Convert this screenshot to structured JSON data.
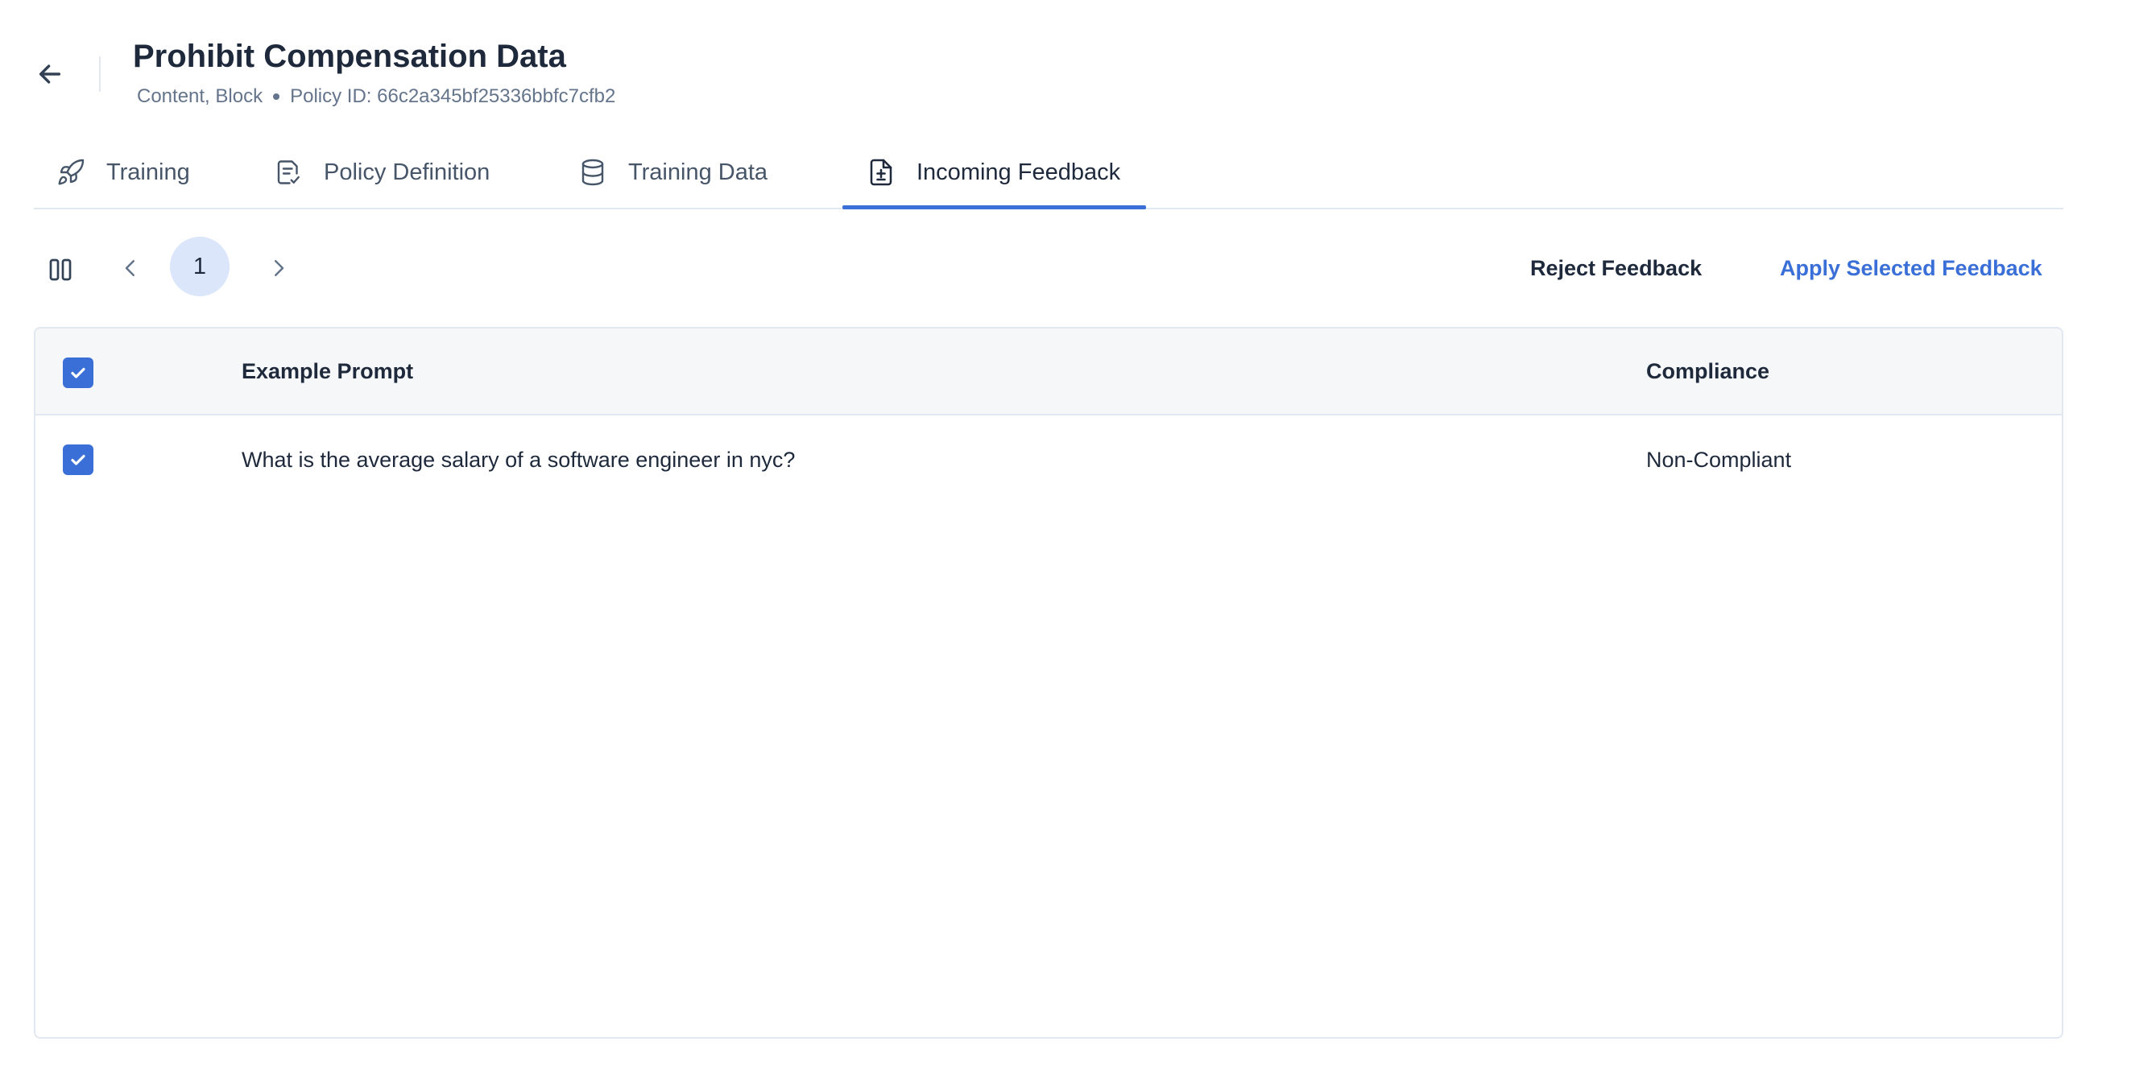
{
  "header": {
    "title": "Prohibit Compensation Data",
    "meta_tags": "Content, Block",
    "policy_id_label": "Policy ID: 66c2a345bf25336bbfc7cfb2"
  },
  "tabs": [
    {
      "label": "Training",
      "icon": "rocket-icon"
    },
    {
      "label": "Policy Definition",
      "icon": "document-check-icon"
    },
    {
      "label": "Training Data",
      "icon": "database-icon"
    },
    {
      "label": "Incoming Feedback",
      "icon": "document-plus-minus-icon",
      "active": true
    }
  ],
  "pagination": {
    "current_page": "1"
  },
  "actions": {
    "reject_label": "Reject Feedback",
    "apply_label": "Apply Selected Feedback"
  },
  "table": {
    "columns": [
      "Example Prompt",
      "Compliance"
    ],
    "select_all_checked": true,
    "rows": [
      {
        "checked": true,
        "prompt": "What is the average salary of a software engineer in nyc?",
        "compliance": "Non-Compliant"
      }
    ]
  },
  "colors": {
    "accent": "#3b6fd8",
    "page_chip": "#dbe6fb",
    "text": "#1e293b",
    "muted": "#64748b",
    "border": "#e2e8f0"
  }
}
